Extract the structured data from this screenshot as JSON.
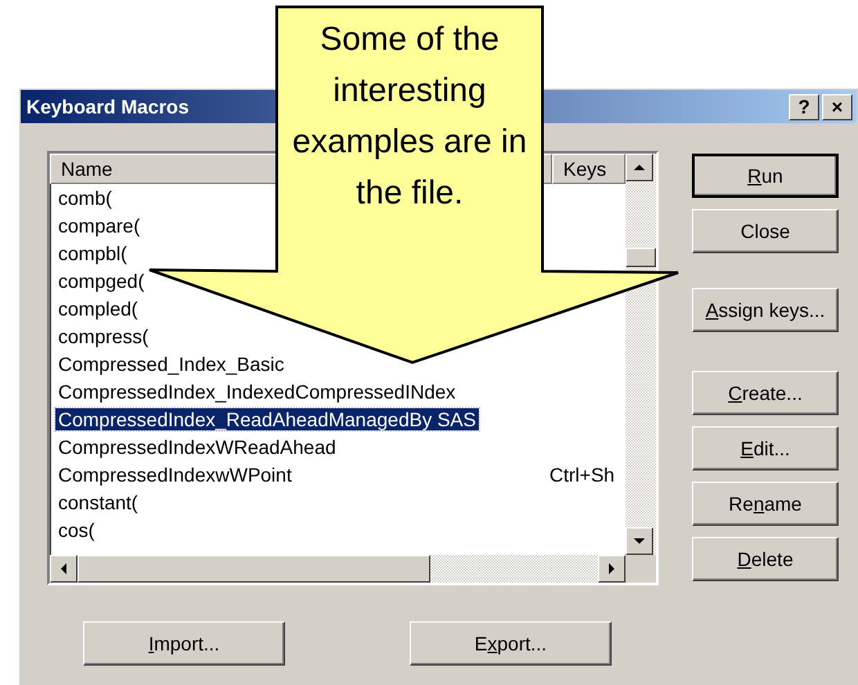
{
  "window": {
    "title": "Keyboard Macros",
    "title_buttons": [
      "?",
      "×"
    ]
  },
  "list": {
    "columns": [
      "Name",
      "Keys"
    ],
    "rows": [
      {
        "name": "comb(",
        "selected": false
      },
      {
        "name": "compare(",
        "selected": false
      },
      {
        "name": "compbl(",
        "selected": false
      },
      {
        "name": "compged(",
        "selected": false
      },
      {
        "name": "compled(",
        "selected": false
      },
      {
        "name": "compress(",
        "selected": false
      },
      {
        "name": "Compressed_Index_Basic",
        "selected": false
      },
      {
        "name": "CompressedIndex_IndexedCompressedINdex",
        "selected": false
      },
      {
        "name": "CompressedIndex_ReadAheadManagedBy SAS",
        "selected": true
      },
      {
        "name": "CompressedIndexWReadAhead",
        "selected": false
      },
      {
        "name": "CompressedIndexwWPoint",
        "keys": "Ctrl+Sh",
        "selected": false
      },
      {
        "name": "constant(",
        "selected": false
      },
      {
        "name": "cos(",
        "selected": false
      }
    ]
  },
  "side_buttons": [
    {
      "key": "R",
      "post": "un",
      "default": true
    },
    {
      "pre": "Close",
      "default": false
    },
    {
      "key": "A",
      "post": "ssign keys...",
      "default": false
    },
    {
      "key": "C",
      "post": "reate...",
      "default": false
    },
    {
      "key": "E",
      "post": "dit...",
      "default": false
    },
    {
      "pre": "Re",
      "key": "n",
      "post": "ame",
      "default": false
    },
    {
      "key": "D",
      "post": "elete",
      "default": false
    }
  ],
  "bottom_buttons": [
    {
      "key": "I",
      "post": "mport...",
      "default": false
    },
    {
      "pre": "E",
      "key": "x",
      "post": "port...",
      "default": false
    }
  ],
  "callout": {
    "text": "Some of the interesting examples are in the file."
  }
}
